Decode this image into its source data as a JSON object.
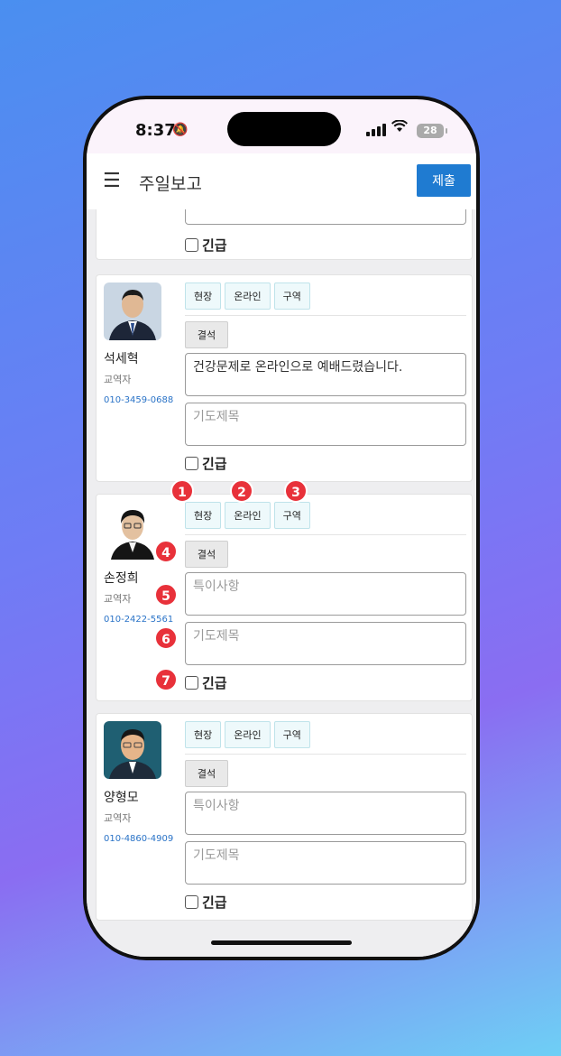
{
  "status": {
    "time": "8:37",
    "battery": "28"
  },
  "appbar": {
    "title": "주일보고",
    "submit_label": "제출"
  },
  "labels": {
    "onsite": "현장",
    "online": "온라인",
    "district": "구역",
    "absent": "결석",
    "notes_placeholder": "특이사항",
    "prayer_placeholder": "기도제목",
    "urgent": "긴급"
  },
  "members": [
    {
      "name": "석세혁",
      "role": "교역자",
      "phone": "010-3459-0688",
      "notes": "건강문제로 온라인으로 예배드렸습니다."
    },
    {
      "name": "손정희",
      "role": "교역자",
      "phone": "010-2422-5561",
      "notes": ""
    },
    {
      "name": "양형모",
      "role": "교역자",
      "phone": "010-4860-4909",
      "notes": ""
    }
  ],
  "markers": [
    "1",
    "2",
    "3",
    "4",
    "5",
    "6",
    "7"
  ],
  "colors": {
    "accent": "#1f7bd1",
    "marker": "#e8313a",
    "phone_link": "#2a73c7"
  }
}
